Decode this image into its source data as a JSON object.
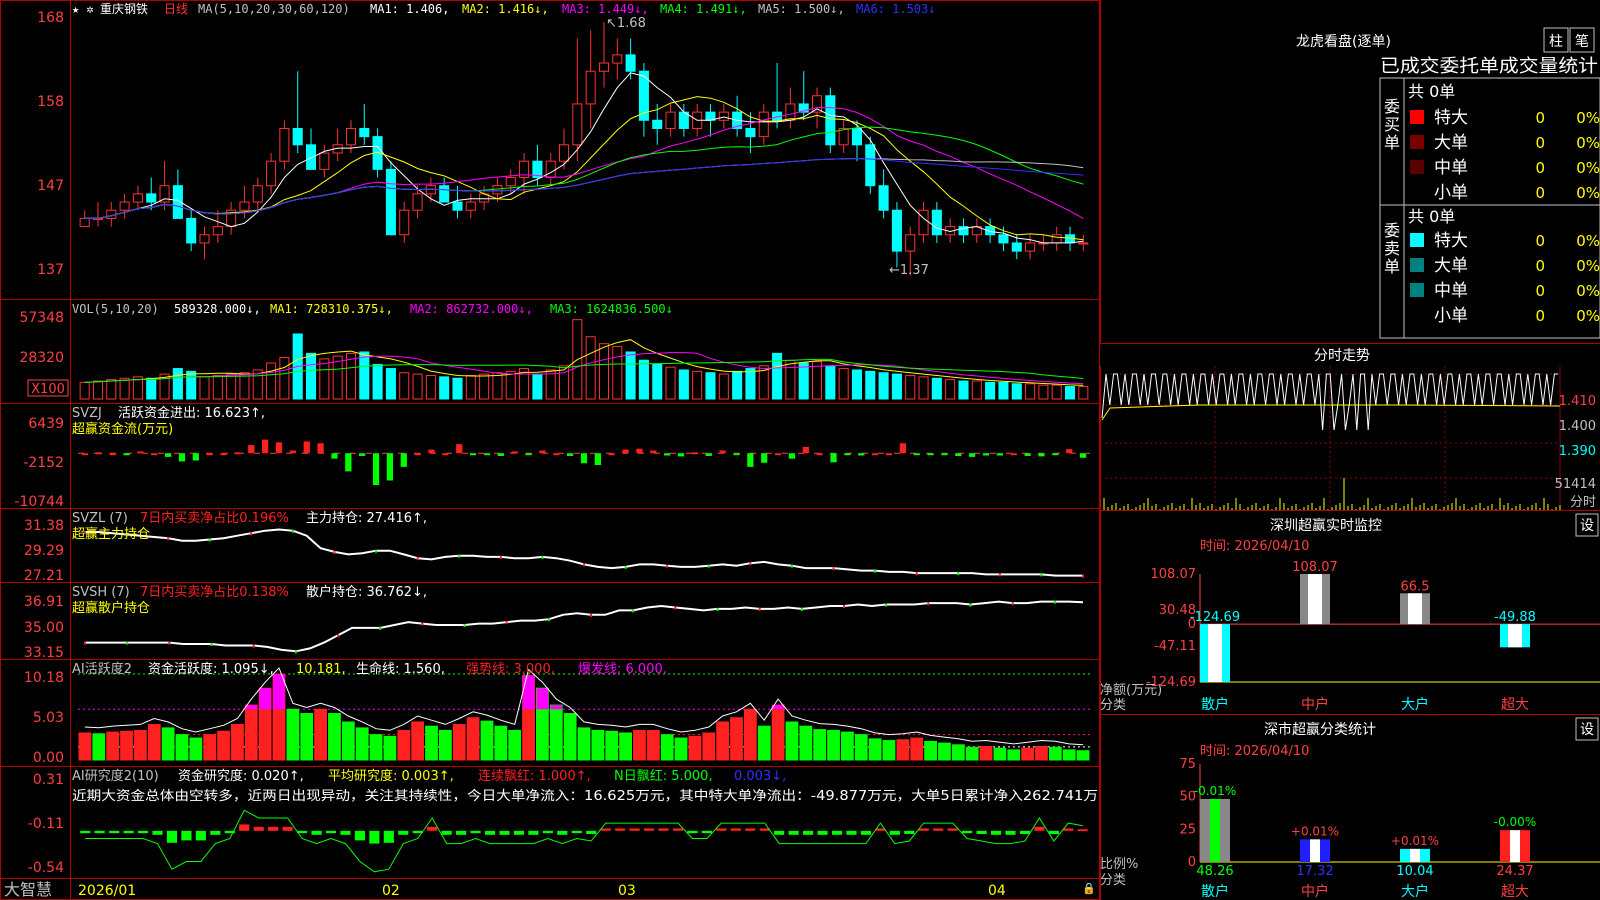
{
  "colors": {
    "up": "#ff3232",
    "down": "#00ffff",
    "green_bar": "#00ff00",
    "red_bar": "#ff2020",
    "ma1": "#ffffff",
    "ma2": "#ffff00",
    "ma3": "#ff00ff",
    "ma4": "#00ff00",
    "ma5": "#c0c0c0",
    "ma6": "#3030ff",
    "grid": "#b00000",
    "axis_text": "#ff4040",
    "yellow": "#ffff00",
    "magenta": "#ff00ff",
    "white": "#ffffff",
    "dark_red": "#7a0000",
    "dark_red2": "#5a0000",
    "teal": "#008080"
  },
  "main": {
    "stock_name": "重庆钢铁",
    "period": "日线",
    "ma_params": "MA(5,10,20,30,60,120)",
    "ma1": "MA1: 1.406,",
    "ma2": "MA2: 1.416↓,",
    "ma3": "MA3: 1.449↓,",
    "ma4": "MA4: 1.491↓,",
    "ma5": "MA5: 1.500↓,",
    "ma6": "MA6: 1.503↓",
    "high_mark": "1.68",
    "low_mark": "1.37",
    "yticks": [
      "168",
      "158",
      "147",
      "137"
    ]
  },
  "vol": {
    "title": "VOL(5,10,20)",
    "value": "589328.000↓,",
    "ma1": "MA1: 728310.375↓,",
    "ma2": "MA2: 862732.000↓,",
    "ma3": "MA3: 1624836.500↓",
    "yticks": [
      "57348",
      "28320"
    ],
    "unit": "X100"
  },
  "svzj": {
    "line1a": "SVZJ",
    "line1b": "活跃资金进出: 16.623↑,",
    "line2": "超赢资金流(万元)",
    "yticks": [
      "6439",
      "-2152",
      "-10744"
    ]
  },
  "svzl": {
    "a": "SVZL (7)",
    "b": "7日内买卖净占比0.196%",
    "c": "主力持仓: 27.416↑,",
    "d": "超赢主力持仓",
    "yticks": [
      "31.38",
      "29.29",
      "27.21"
    ]
  },
  "svsh": {
    "a": "SVSH (7)",
    "b": "7日内买卖净占比0.138%",
    "c": "散户持仓: 36.762↓,",
    "d": "超赢散户持仓",
    "yticks": [
      "36.91",
      "35.00",
      "33.15"
    ]
  },
  "ai1": {
    "a": "AI活跃度2",
    "b": "资金活跃度: 1.095↓,",
    "c": "10.181,",
    "d": "生命线: 1.560,",
    "e": "强势线: 3.000,",
    "f": "爆发线: 6.000,",
    "yticks": [
      "10.18",
      "5.03",
      "0.00"
    ]
  },
  "ai2": {
    "a": "AI研究度2(10)",
    "b": "资金研究度: 0.020↑,",
    "c": "平均研究度: 0.003↑,",
    "d": "连续飘红: 1.000↑,",
    "e": "N日飘红: 5.000,",
    "f": "0.003↓,",
    "note": "近期大资金总体由空转多，近两日出现异动，关注其持续性，今日大单净流入：16.625万元，其中特大单净流出：-49.877万元，大单5日累计净入262.741万",
    "yticks": [
      "0.31",
      "-0.11",
      "-0.54"
    ]
  },
  "xaxis": {
    "labels": [
      "2026/01",
      "02",
      "03",
      "04"
    ]
  },
  "bottom_left": "大智慧",
  "longhu": {
    "title": "龙虎看盘(逐单)",
    "btn1": "柱",
    "btn2": "笔",
    "tabs": "已成交委托单成交量统计",
    "buy_header": "共 0单",
    "sell_header": "共 0单",
    "buy_label": "委买单",
    "sell_label": "委卖单",
    "buy_rows": [
      {
        "name": "特大",
        "count": "0",
        "pct": "0%",
        "color": "#ff0000"
      },
      {
        "name": "大单",
        "count": "0",
        "pct": "0%",
        "color": "#7a0000"
      },
      {
        "name": "中单",
        "count": "0",
        "pct": "0%",
        "color": "#5a0000"
      },
      {
        "name": "小单",
        "count": "0",
        "pct": "0%",
        "color": ""
      }
    ],
    "sell_rows": [
      {
        "name": "特大",
        "count": "0",
        "pct": "0%",
        "color": "#00ffff"
      },
      {
        "name": "大单",
        "count": "0",
        "pct": "0%",
        "color": "#008080"
      },
      {
        "name": "中单",
        "count": "0",
        "pct": "0%",
        "color": "#008080"
      },
      {
        "name": "小单",
        "count": "0",
        "pct": "0%",
        "color": ""
      }
    ]
  },
  "fenshi": {
    "title": "分时走势",
    "prices": [
      "1.410",
      "1.400",
      "1.390"
    ],
    "vol_label": "51414",
    "unit": "分时"
  },
  "sz_monitor": {
    "title": "深圳超赢实时监控",
    "set": "设",
    "time": "时间: 2026/04/10",
    "yticks": [
      "108.07",
      "30.48",
      "0",
      "-47.11",
      "-124.69"
    ],
    "ylabel": "净额(万元)",
    "xlabel": "分类",
    "categories": [
      "散户",
      "中户",
      "大户",
      "超大"
    ],
    "values": [
      -124.69,
      108.07,
      66.5,
      -49.88
    ],
    "value_labels": [
      "-124.69",
      "108.07",
      "66.5",
      "-49.88"
    ]
  },
  "sz_class": {
    "title": "深市超赢分类统计",
    "set": "设",
    "time": "时间: 2026/04/10",
    "yticks": [
      "75",
      "50",
      "25",
      "0"
    ],
    "ylabel": "比例%",
    "xlabel": "分类",
    "categories": [
      "散户",
      "中户",
      "大户",
      "超大"
    ],
    "values": [
      48.26,
      17.32,
      10.04,
      24.37
    ],
    "value_labels": [
      "48.26",
      "17.32",
      "10.04",
      "24.37"
    ],
    "change_labels": [
      "-0.01%",
      "+0.01%",
      "+0.01%",
      "-0.00%"
    ]
  },
  "chart_data": [
    {
      "type": "candlestick",
      "title": "重庆钢铁 日线",
      "ylim": [
        1.35,
        1.69
      ],
      "ohlc": [
        [
          1.43,
          1.45,
          1.43,
          1.44
        ],
        [
          1.44,
          1.46,
          1.43,
          1.44
        ],
        [
          1.44,
          1.46,
          1.43,
          1.45
        ],
        [
          1.45,
          1.47,
          1.44,
          1.46
        ],
        [
          1.46,
          1.48,
          1.45,
          1.47
        ],
        [
          1.47,
          1.49,
          1.45,
          1.46
        ],
        [
          1.46,
          1.51,
          1.45,
          1.48
        ],
        [
          1.48,
          1.5,
          1.44,
          1.44
        ],
        [
          1.44,
          1.45,
          1.4,
          1.41
        ],
        [
          1.41,
          1.43,
          1.39,
          1.42
        ],
        [
          1.42,
          1.45,
          1.41,
          1.43
        ],
        [
          1.43,
          1.46,
          1.42,
          1.45
        ],
        [
          1.45,
          1.48,
          1.44,
          1.46
        ],
        [
          1.46,
          1.49,
          1.45,
          1.48
        ],
        [
          1.48,
          1.52,
          1.47,
          1.51
        ],
        [
          1.51,
          1.56,
          1.5,
          1.55
        ],
        [
          1.55,
          1.62,
          1.52,
          1.53
        ],
        [
          1.53,
          1.55,
          1.5,
          1.5
        ],
        [
          1.5,
          1.53,
          1.49,
          1.52
        ],
        [
          1.52,
          1.55,
          1.51,
          1.53
        ],
        [
          1.53,
          1.56,
          1.52,
          1.55
        ],
        [
          1.55,
          1.58,
          1.53,
          1.54
        ],
        [
          1.54,
          1.55,
          1.49,
          1.5
        ],
        [
          1.5,
          1.51,
          1.42,
          1.42
        ],
        [
          1.42,
          1.46,
          1.41,
          1.45
        ],
        [
          1.45,
          1.48,
          1.44,
          1.47
        ],
        [
          1.47,
          1.49,
          1.46,
          1.48
        ],
        [
          1.48,
          1.49,
          1.46,
          1.46
        ],
        [
          1.46,
          1.48,
          1.44,
          1.45
        ],
        [
          1.45,
          1.47,
          1.44,
          1.46
        ],
        [
          1.46,
          1.48,
          1.45,
          1.47
        ],
        [
          1.47,
          1.49,
          1.46,
          1.48
        ],
        [
          1.48,
          1.5,
          1.47,
          1.49
        ],
        [
          1.49,
          1.52,
          1.47,
          1.51
        ],
        [
          1.51,
          1.53,
          1.48,
          1.49
        ],
        [
          1.49,
          1.52,
          1.48,
          1.51
        ],
        [
          1.51,
          1.55,
          1.5,
          1.53
        ],
        [
          1.53,
          1.66,
          1.51,
          1.58
        ],
        [
          1.58,
          1.67,
          1.55,
          1.62
        ],
        [
          1.62,
          1.68,
          1.6,
          1.63
        ],
        [
          1.63,
          1.66,
          1.61,
          1.64
        ],
        [
          1.64,
          1.66,
          1.61,
          1.62
        ],
        [
          1.62,
          1.63,
          1.54,
          1.56
        ],
        [
          1.56,
          1.58,
          1.53,
          1.55
        ],
        [
          1.55,
          1.58,
          1.54,
          1.57
        ],
        [
          1.57,
          1.58,
          1.54,
          1.55
        ],
        [
          1.55,
          1.58,
          1.54,
          1.57
        ],
        [
          1.57,
          1.58,
          1.54,
          1.56
        ],
        [
          1.56,
          1.58,
          1.55,
          1.57
        ],
        [
          1.57,
          1.59,
          1.54,
          1.55
        ],
        [
          1.55,
          1.57,
          1.52,
          1.54
        ],
        [
          1.54,
          1.58,
          1.53,
          1.57
        ],
        [
          1.57,
          1.63,
          1.55,
          1.56
        ],
        [
          1.56,
          1.6,
          1.55,
          1.58
        ],
        [
          1.58,
          1.62,
          1.56,
          1.57
        ],
        [
          1.57,
          1.6,
          1.55,
          1.59
        ],
        [
          1.59,
          1.6,
          1.52,
          1.53
        ],
        [
          1.53,
          1.56,
          1.52,
          1.55
        ],
        [
          1.55,
          1.56,
          1.51,
          1.53
        ],
        [
          1.53,
          1.54,
          1.47,
          1.48
        ],
        [
          1.48,
          1.5,
          1.44,
          1.45
        ],
        [
          1.45,
          1.46,
          1.38,
          1.4
        ],
        [
          1.4,
          1.43,
          1.37,
          1.42
        ],
        [
          1.42,
          1.46,
          1.41,
          1.45
        ],
        [
          1.45,
          1.46,
          1.41,
          1.42
        ],
        [
          1.42,
          1.44,
          1.41,
          1.43
        ],
        [
          1.43,
          1.44,
          1.41,
          1.42
        ],
        [
          1.42,
          1.44,
          1.41,
          1.43
        ],
        [
          1.43,
          1.44,
          1.41,
          1.42
        ],
        [
          1.42,
          1.43,
          1.4,
          1.41
        ],
        [
          1.41,
          1.42,
          1.39,
          1.4
        ],
        [
          1.4,
          1.42,
          1.39,
          1.41
        ],
        [
          1.41,
          1.42,
          1.4,
          1.41
        ],
        [
          1.41,
          1.43,
          1.4,
          1.42
        ],
        [
          1.42,
          1.43,
          1.4,
          1.41
        ],
        [
          1.41,
          1.42,
          1.4,
          1.41
        ]
      ]
    },
    {
      "type": "bar",
      "title": "VOL(5,10,20)",
      "ylim": [
        0,
        60000
      ],
      "values": [
        12000,
        13000,
        14000,
        15000,
        16000,
        15000,
        18000,
        22000,
        20000,
        16000,
        17000,
        18000,
        19000,
        21000,
        26000,
        30000,
        47000,
        33000,
        29000,
        31000,
        33000,
        34000,
        25000,
        22000,
        19000,
        18000,
        17000,
        16000,
        15000,
        17000,
        18000,
        19000,
        20000,
        22000,
        18000,
        21000,
        24000,
        57348,
        45000,
        40000,
        38000,
        34000,
        28000,
        25000,
        23000,
        21000,
        20000,
        19000,
        18000,
        20000,
        22000,
        24000,
        33000,
        28000,
        26000,
        27000,
        24000,
        22000,
        21000,
        20000,
        19000,
        18000,
        17000,
        16000,
        15000,
        14000,
        13000,
        13000,
        12000,
        12000,
        11000,
        11000,
        10000,
        10000,
        9000,
        9000
      ]
    },
    {
      "type": "bar",
      "title": "超赢资金流(万元)",
      "ylim": [
        -10744,
        6439
      ],
      "values": [
        0,
        200,
        0,
        -200,
        400,
        0,
        -800,
        -1800,
        -1600,
        0,
        0,
        200,
        1800,
        3000,
        2400,
        600,
        2600,
        2200,
        -1200,
        -4000,
        -600,
        -7000,
        -6000,
        -3000,
        0,
        800,
        0,
        2000,
        -300,
        -200,
        -600,
        400,
        -200,
        600,
        0,
        -600,
        -2200,
        -2600,
        0,
        800,
        1000,
        600,
        -500,
        -700,
        200,
        -600,
        600,
        -300,
        -3000,
        -2100,
        0,
        -1200,
        1400,
        0,
        -2000,
        -300,
        -500,
        0,
        0,
        2200,
        -200,
        -200,
        -300,
        -600,
        -800,
        -500,
        -500,
        0,
        -600,
        -700,
        -100,
        900,
        -1000
      ]
    },
    {
      "type": "line",
      "title": "超赢主力持仓",
      "ylim": [
        27.21,
        31.38
      ],
      "series": [
        {
          "name": "主力持仓",
          "values": [
            30.9,
            30.9,
            30.8,
            30.7,
            30.6,
            30.5,
            30.4,
            30.2,
            30.2,
            30.3,
            30.4,
            30.6,
            30.8,
            31.0,
            31.1,
            31.0,
            30.6,
            29.6,
            29.3,
            29.1,
            29.2,
            29.4,
            29.4,
            29.1,
            28.8,
            28.7,
            28.9,
            29.0,
            29.0,
            28.9,
            28.9,
            28.8,
            28.8,
            28.9,
            28.8,
            28.6,
            28.3,
            28.1,
            28.0,
            28.1,
            28.3,
            28.3,
            28.2,
            28.1,
            28.1,
            28.2,
            28.3,
            28.2,
            28.4,
            28.5,
            28.3,
            28.2,
            28.0,
            28.0,
            28.0,
            27.9,
            27.8,
            27.8,
            27.7,
            27.7,
            27.6,
            27.6,
            27.6,
            27.6,
            27.6,
            27.5,
            27.5,
            27.5,
            27.5,
            27.5,
            27.4,
            27.4,
            27.4
          ]
        }
      ]
    },
    {
      "type": "line",
      "title": "超赢散户持仓",
      "ylim": [
        33.15,
        36.91
      ],
      "series": [
        {
          "name": "散户持仓",
          "values": [
            34.0,
            34.0,
            34.0,
            34.0,
            34.0,
            34.0,
            34.0,
            33.9,
            33.9,
            33.9,
            33.8,
            33.8,
            33.8,
            33.7,
            33.5,
            33.4,
            33.6,
            34.0,
            34.5,
            35.0,
            35.0,
            35.0,
            35.2,
            35.4,
            35.3,
            35.2,
            35.2,
            35.2,
            35.3,
            35.3,
            35.4,
            35.5,
            35.5,
            35.6,
            35.9,
            36.0,
            35.9,
            35.9,
            36.2,
            36.2,
            36.4,
            36.5,
            36.4,
            36.3,
            36.2,
            36.3,
            36.3,
            36.4,
            36.3,
            36.3,
            36.4,
            36.3,
            36.4,
            36.5,
            36.5,
            36.6,
            36.5,
            36.6,
            36.6,
            36.6,
            36.7,
            36.7,
            36.7,
            36.6,
            36.7,
            36.8,
            36.7,
            36.7,
            36.8,
            36.8,
            36.8,
            36.76
          ]
        }
      ]
    },
    {
      "type": "bar",
      "title": "AI活跃度2",
      "ylim": [
        0,
        10.18
      ],
      "values": [
        3.2,
        3.1,
        3.3,
        3.4,
        3.5,
        4.2,
        3.8,
        3.0,
        2.6,
        3.0,
        3.4,
        4.2,
        6.5,
        8.5,
        10.18,
        6.0,
        5.5,
        6.0,
        5.5,
        4.5,
        3.8,
        3.0,
        2.8,
        3.5,
        4.5,
        4.0,
        3.5,
        4.2,
        5.0,
        4.6,
        4.0,
        3.5,
        10.0,
        8.5,
        6.5,
        5.5,
        3.8,
        3.5,
        3.4,
        3.2,
        3.5,
        3.5,
        3.0,
        2.6,
        2.8,
        3.2,
        4.5,
        5.0,
        6.0,
        4.0,
        6.5,
        4.5,
        4.0,
        3.6,
        3.5,
        3.3,
        3.0,
        2.5,
        2.3,
        2.4,
        2.6,
        2.2,
        2.0,
        1.8,
        1.5,
        1.6,
        1.4,
        1.2,
        1.4,
        1.6,
        1.5,
        1.2,
        1.1
      ]
    },
    {
      "type": "bar",
      "title": "AI研究度2(10)",
      "ylim": [
        -0.54,
        0.31
      ],
      "values": [
        -0.03,
        -0.03,
        -0.03,
        -0.03,
        -0.03,
        -0.05,
        -0.15,
        -0.12,
        -0.12,
        -0.05,
        -0.03,
        0.08,
        0.05,
        0.05,
        0.05,
        -0.03,
        -0.05,
        -0.03,
        -0.05,
        -0.12,
        -0.16,
        -0.15,
        -0.05,
        -0.03,
        0.05,
        -0.05,
        -0.05,
        -0.03,
        -0.05,
        -0.05,
        -0.05,
        -0.05,
        -0.03,
        -0.05,
        -0.03,
        -0.04,
        0.03,
        0.03,
        0.03,
        0.03,
        0.03,
        0.03,
        -0.03,
        -0.03,
        0.03,
        0.03,
        0.03,
        0.03,
        -0.05,
        -0.05,
        -0.05,
        -0.05,
        -0.05,
        -0.05,
        -0.05,
        0.03,
        -0.05,
        -0.04,
        0.03,
        0.03,
        0.03,
        -0.03,
        -0.04,
        -0.05,
        -0.05,
        -0.04,
        0.05,
        -0.04,
        0.03,
        0.02
      ]
    },
    {
      "type": "bar",
      "title": "深圳超赢实时监控",
      "categories": [
        "散户",
        "中户",
        "大户",
        "超大"
      ],
      "values": [
        -124.69,
        108.07,
        66.5,
        -49.88
      ],
      "ylabel": "净额(万元)",
      "xlabel": "分类",
      "ylim": [
        -124.69,
        108.07
      ]
    },
    {
      "type": "bar",
      "title": "深市超赢分类统计",
      "categories": [
        "散户",
        "中户",
        "大户",
        "超大"
      ],
      "values": [
        48.26,
        17.32,
        10.04,
        24.37
      ],
      "ylabel": "比例%",
      "xlabel": "分类",
      "ylim": [
        0,
        75
      ]
    }
  ]
}
